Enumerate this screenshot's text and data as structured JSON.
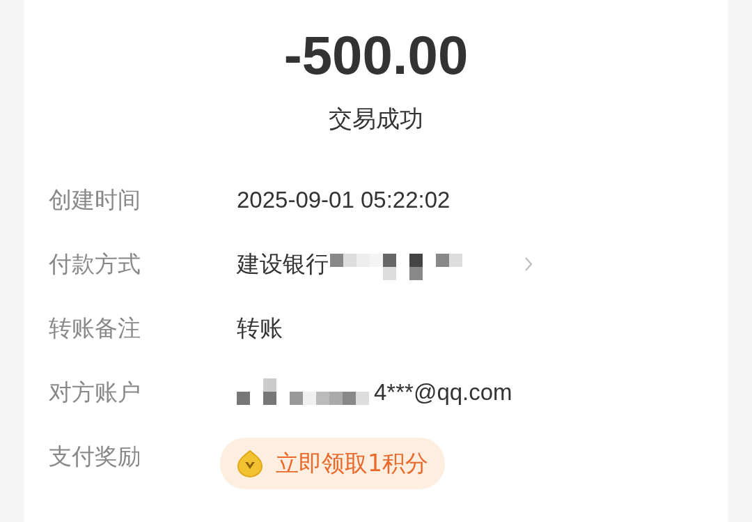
{
  "amount": "-500.00",
  "status": "交易成功",
  "details": [
    {
      "kind": "text",
      "label": "创建时间",
      "value": "2025-09-01 05:22:02"
    },
    {
      "kind": "masked_link",
      "label": "付款方式",
      "value": "建设银行"
    },
    {
      "kind": "text",
      "label": "转账备注",
      "value": "转账"
    },
    {
      "kind": "masked_suffix",
      "label": "对方账户",
      "value": "4***@qq.com"
    },
    {
      "kind": "reward",
      "label": "支付奖励",
      "value": "立即领取1积分"
    }
  ]
}
